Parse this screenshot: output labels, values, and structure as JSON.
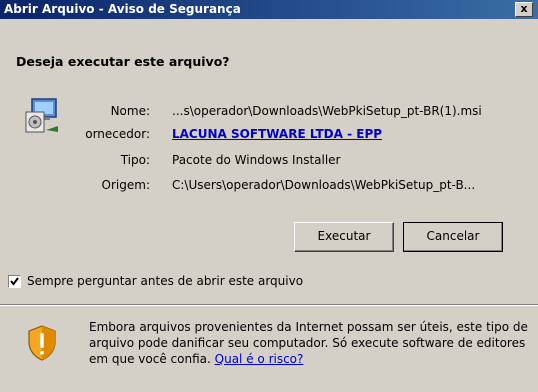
{
  "window": {
    "title": "Abrir Arquivo - Aviso de Segurança",
    "close_label": "x"
  },
  "dialog": {
    "question": "Deseja executar este arquivo?",
    "file_icon": "installer-package-icon",
    "fields": {
      "name_label": "Nome:",
      "name_value": "...s\\operador\\Downloads\\WebPkiSetup_pt-BR(1).msi",
      "publisher_label": "ornecedor:",
      "publisher_value": "LACUNA SOFTWARE LTDA - EPP",
      "type_label": "Tipo:",
      "type_value": "Pacote do Windows Installer",
      "origin_label": "Origem:",
      "origin_value": "C:\\Users\\operador\\Downloads\\WebPkiSetup_pt-B..."
    },
    "buttons": {
      "execute": "Executar",
      "cancel": "Cancelar"
    },
    "checkbox": {
      "label": "Sempre perguntar antes de abrir este arquivo",
      "checked": true
    },
    "warning": {
      "icon": "shield-warning-icon",
      "text": "Embora arquivos provenientes da Internet possam ser úteis, este tipo de arquivo pode danificar seu computador. Só execute software de editores em que você confia.",
      "link": "Qual é o risco?"
    }
  },
  "colors": {
    "title_bar_start": "#0a246a",
    "title_bar_end": "#3a6ea5",
    "dialog_bg": "#d4d0c8",
    "link": "#0000cc"
  }
}
